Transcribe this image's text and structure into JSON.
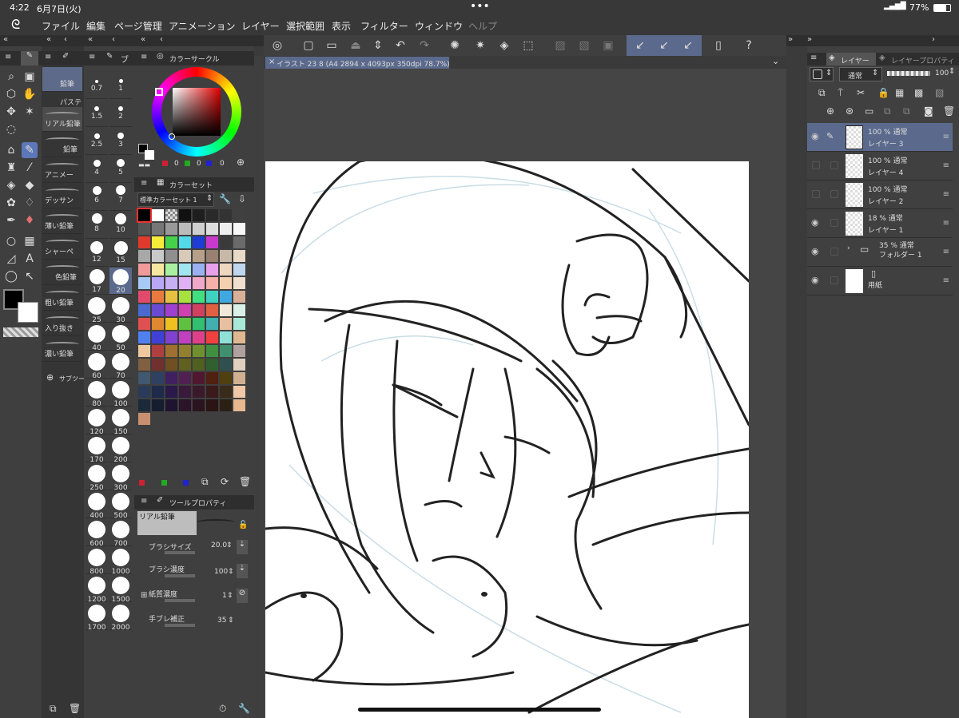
{
  "status": {
    "time": "4:22",
    "date": "6月7日(火)",
    "battery": "77%"
  },
  "menu": [
    "ファイル",
    "編集",
    "ページ管理",
    "アニメーション",
    "レイヤー",
    "選択範囲",
    "表示",
    "フィルター",
    "ウィンドウ",
    "ヘルプ"
  ],
  "canvas_tab": "イラスト 23 8 (A4 2894 x 4093px 350dpi 78.7%)",
  "brush_group": "鉛筆",
  "brush_tab_short": "ブ",
  "brushes": [
    "鉛筆",
    "パステ",
    "リアル鉛筆",
    "鉛筆",
    "アニメー",
    "デッサン",
    "薄い鉛筆",
    "シャーペ",
    "色鉛筆",
    "粗い鉛筆",
    "入り抜き",
    "濃い鉛筆"
  ],
  "sub_tool_add": "サブツー",
  "brush_sizes": [
    "0.7",
    "1",
    "1.5",
    "2",
    "2.5",
    "3",
    "4",
    "5",
    "6",
    "7",
    "8",
    "10",
    "12",
    "15",
    "17",
    "20",
    "25",
    "30",
    "40",
    "50",
    "60",
    "70",
    "80",
    "100",
    "120",
    "150",
    "170",
    "200",
    "250",
    "300",
    "400",
    "500",
    "600",
    "700",
    "800",
    "1000",
    "1200",
    "1500",
    "1700",
    "2000"
  ],
  "color_circle": {
    "title": "カラーサークル",
    "r": "0",
    "g": "0",
    "b": "0"
  },
  "color_set": {
    "title": "カラーセット",
    "preset": "標準カラーセット 1"
  },
  "palette_colors": [
    "#000000",
    "#ffffff",
    "#cccccc",
    "#111111",
    "#1e1e1e",
    "#2a2a2a",
    "#333333",
    "#404040",
    "#555555",
    "#777777",
    "#999999",
    "#bbbbbb",
    "#cfcfcf",
    "#dedede",
    "#eeeeee",
    "#f7f7f7",
    "#e03a2c",
    "#f7ec3a",
    "#45d24a",
    "#54d9e9",
    "#1e3cd6",
    "#c73acd",
    "#3a3a3a",
    "#6b6b6b",
    "#a8a8a8",
    "#c9c9c9",
    "#8f8f8f",
    "#d9c9b9",
    "#b8a088",
    "#9a8070",
    "#c8b8a8",
    "#e9d9c9",
    "#f19a9a",
    "#f7e6a0",
    "#a8efa0",
    "#a0e6f0",
    "#9ab0f0",
    "#e7a0ea",
    "#efd6c0",
    "#c0d6ef",
    "#a8c8f5",
    "#b8a8f5",
    "#c8b0f5",
    "#e0b0f5",
    "#f0a8c8",
    "#f5b0a8",
    "#f5d0b0",
    "#f0e0d0",
    "#e14a6a",
    "#e87a40",
    "#e8c040",
    "#a8e040",
    "#40e080",
    "#40d0c0",
    "#40a8e0",
    "#d8b098",
    "#4a6ad0",
    "#6a4ad0",
    "#a040d0",
    "#d040b0",
    "#d04060",
    "#e06040",
    "#f0e8d8",
    "#d8f0e8",
    "#e05050",
    "#e08830",
    "#f0c020",
    "#60c040",
    "#30c070",
    "#40b0b0",
    "#e8c0a0",
    "#a8e8d8",
    "#5080f0",
    "#4040d8",
    "#8040d0",
    "#c040c0",
    "#e0408a",
    "#f04040",
    "#90e0d8",
    "#e0b890",
    "#f0c8a0",
    "#b04040",
    "#a07030",
    "#908030",
    "#709030",
    "#409040",
    "#409070",
    "#b0a0a0",
    "#806040",
    "#703030",
    "#705020",
    "#606020",
    "#506020",
    "#306030",
    "#305050",
    "#e0d0c0",
    "#405870",
    "#304060",
    "#402060",
    "#502050",
    "#501830",
    "#502010",
    "#504010",
    "#d0b090",
    "#2a3a5a",
    "#1e2a4a",
    "#2a1a4a",
    "#3a1a3a",
    "#3a1a2a",
    "#3a1a1a",
    "#3a2a1a",
    "#f0c8a8",
    "#1a2a3a",
    "#141e30",
    "#1e1430",
    "#2a1428",
    "#2a1420",
    "#2a1414",
    "#2a2014",
    "#e8b890",
    "#c89070"
  ],
  "tool_property": {
    "title": "ツールプロパティ",
    "brush_name": "リアル鉛筆",
    "size_label": "ブラシサイズ",
    "size_value": "20.0",
    "density_label": "ブラシ濃度",
    "density_value": "100",
    "paper_label": "紙質濃度",
    "paper_value": "1",
    "stabilization_label": "手ブレ補正",
    "stabilization_value": "35"
  },
  "layer_panel": {
    "tab_layer": "レイヤー",
    "tab_property": "レイヤープロパティ",
    "blend_mode": "通常",
    "opacity": "100"
  },
  "layers": [
    {
      "pct": "100 % 通常",
      "name": "レイヤー 3",
      "eye": "true",
      "selected": "true"
    },
    {
      "pct": "100 % 通常",
      "name": "レイヤー 4",
      "eye": "false",
      "selected": "false"
    },
    {
      "pct": "100 % 通常",
      "name": "レイヤー 2",
      "eye": "false",
      "selected": "false"
    },
    {
      "pct": "18 % 通常",
      "name": "レイヤー 1",
      "eye": "true",
      "selected": "false"
    },
    {
      "pct": "35 % 通常",
      "name": "フォルダー 1",
      "eye": "true",
      "selected": "false"
    },
    {
      "pct": "",
      "name": "用紙",
      "eye": "true",
      "selected": "false"
    }
  ],
  "icons": {
    "app_logo": "clip-studio-logo-icon",
    "wifi": "wifi-icon",
    "battery": "battery-icon",
    "pen": "pen-icon",
    "undo": "undo-icon",
    "redo": "redo-icon"
  }
}
